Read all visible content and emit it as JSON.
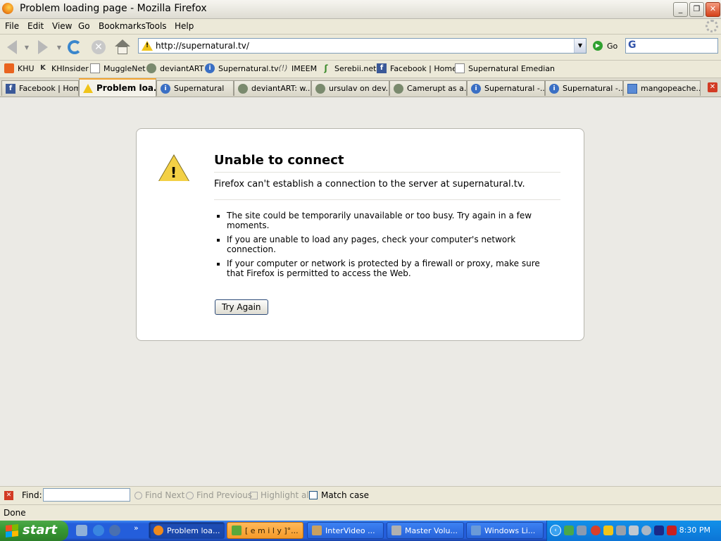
{
  "window": {
    "title": "Problem loading page - Mozilla Firefox",
    "buttons": {
      "minimize": "_",
      "maximize": "❐",
      "close": "✕"
    }
  },
  "menu": [
    "File",
    "Edit",
    "View",
    "Go",
    "Bookmarks",
    "Tools",
    "Help"
  ],
  "nav": {
    "url": "http://supernatural.tv/",
    "go_label": "Go",
    "search_value": ""
  },
  "bookmarks": [
    {
      "label": "KHU",
      "icon": "khu-icon"
    },
    {
      "label": "KHInsider",
      "icon": "khinsider-icon"
    },
    {
      "label": "MuggleNet",
      "icon": "page-icon"
    },
    {
      "label": "deviantART",
      "icon": "deviantart-icon"
    },
    {
      "label": "Supernatural.tv",
      "icon": "info-icon"
    },
    {
      "label": "IMEEM",
      "icon": "imeem-icon"
    },
    {
      "label": "Serebii.net",
      "icon": "serebii-icon"
    },
    {
      "label": "Facebook | Home",
      "icon": "facebook-icon"
    },
    {
      "label": "Supernatural Emedian",
      "icon": "page-icon"
    }
  ],
  "tabs": [
    {
      "label": "Facebook | Home",
      "icon": "facebook-icon",
      "active": false
    },
    {
      "label": "Problem loa...",
      "icon": "warning-icon",
      "active": true
    },
    {
      "label": "Supernatural",
      "icon": "info-icon",
      "active": false
    },
    {
      "label": "deviantART: w...",
      "icon": "deviantart-icon",
      "active": false
    },
    {
      "label": "ursulav on dev...",
      "icon": "deviantart-icon",
      "active": false
    },
    {
      "label": "Camerupt as a...",
      "icon": "deviantart-icon",
      "active": false
    },
    {
      "label": "Supernatural -...",
      "icon": "info-icon",
      "active": false
    },
    {
      "label": "Supernatural -...",
      "icon": "info-icon",
      "active": false
    },
    {
      "label": "mangopeache...",
      "icon": "mango-icon",
      "active": false
    }
  ],
  "error": {
    "title": "Unable to connect",
    "intro": "Firefox can't establish a connection to the server at supernatural.tv.",
    "bullets": [
      "The site could be temporarily unavailable or too busy. Try again in a few moments.",
      "If you are unable to load any pages, check your computer's network connection.",
      "If your computer or network is protected by a firewall or proxy, make sure that Firefox is permitted to access the Web."
    ],
    "button_label": "Try Again"
  },
  "findbar": {
    "label": "Find:",
    "find_next": "Find Next",
    "find_previous": "Find Previous",
    "highlight_all": "Highlight all",
    "match_case": "Match case",
    "value": ""
  },
  "status": {
    "text": "Done"
  },
  "taskbar": {
    "start_label": "start",
    "items": [
      {
        "label": "Problem loa...",
        "active": true,
        "style": "normal",
        "icon_color": "#f08a1c"
      },
      {
        "label": "[ e m i l y ]°...",
        "active": false,
        "style": "orange",
        "icon_color": "#5aa83a"
      },
      {
        "label": "InterVideo ...",
        "active": false,
        "style": "normal",
        "icon_color": "#c8a060"
      },
      {
        "label": "Master Volu...",
        "active": false,
        "style": "normal",
        "icon_color": "#b0b0b0"
      },
      {
        "label": "Windows Li...",
        "active": false,
        "style": "normal",
        "icon_color": "#6a9ad8"
      }
    ],
    "clock": "8:30 PM"
  }
}
